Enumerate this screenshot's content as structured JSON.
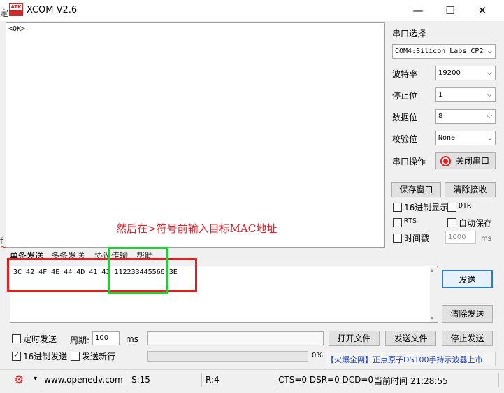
{
  "window": {
    "logo_text": "ATK",
    "title": "XCOM V2.6",
    "min_glyph": "—",
    "max_glyph": "☐",
    "close_glyph": "✕"
  },
  "edge_fragments": [
    "定",
    "f",
    "~"
  ],
  "receive": {
    "content": "<OK>"
  },
  "serial": {
    "section_title": "串口选择",
    "port_value": "COM4:Silicon Labs CP2",
    "baud_label": "波特率",
    "baud_value": "19200",
    "stopbit_label": "停止位",
    "stopbit_value": "1",
    "databit_label": "数据位",
    "databit_value": "8",
    "parity_label": "校验位",
    "parity_value": "None",
    "op_label": "串口操作",
    "op_button": "关闭串口",
    "status_color": "#e81e1e"
  },
  "recv_buttons": {
    "save": "保存窗口",
    "clear": "清除接收"
  },
  "recv_options": {
    "hex_display": "16进制显示",
    "dtr": "DTR",
    "rts": "RTS",
    "auto_save": "自动保存",
    "timestamp": "时间戳",
    "timestamp_value": "1000",
    "timestamp_unit": "ms"
  },
  "annotation": "然后在>符号前输入目标MAC地址",
  "tabs": {
    "single": "单条发送",
    "multi": "多条发送",
    "proto": "协议传输",
    "help": "帮助"
  },
  "send": {
    "content": "3C 42 4F 4E 44 4D 41 43 112233445566 3E",
    "send_button": "发送",
    "clear_button": "清除发送"
  },
  "bottom": {
    "timed_send": "定时发送",
    "period_label": "周期:",
    "period_value": "100",
    "period_unit": "ms",
    "open_file": "打开文件",
    "send_file": "发送文件",
    "stop_send": "停止发送",
    "hex_send": "16进制发送",
    "newline": "发送新行",
    "progress": "0%",
    "progress_fraction": 0,
    "ad_text": "【火爆全网】正点原子DS100手持示波器上市"
  },
  "status": {
    "gear": "⚙",
    "dropdown": "▾",
    "url": "www.openedv.com",
    "sent": "S:15",
    "received": "R:4",
    "lines": "CTS=0 DSR=0 DCD=0",
    "time": "当前时间 21:28:55"
  }
}
